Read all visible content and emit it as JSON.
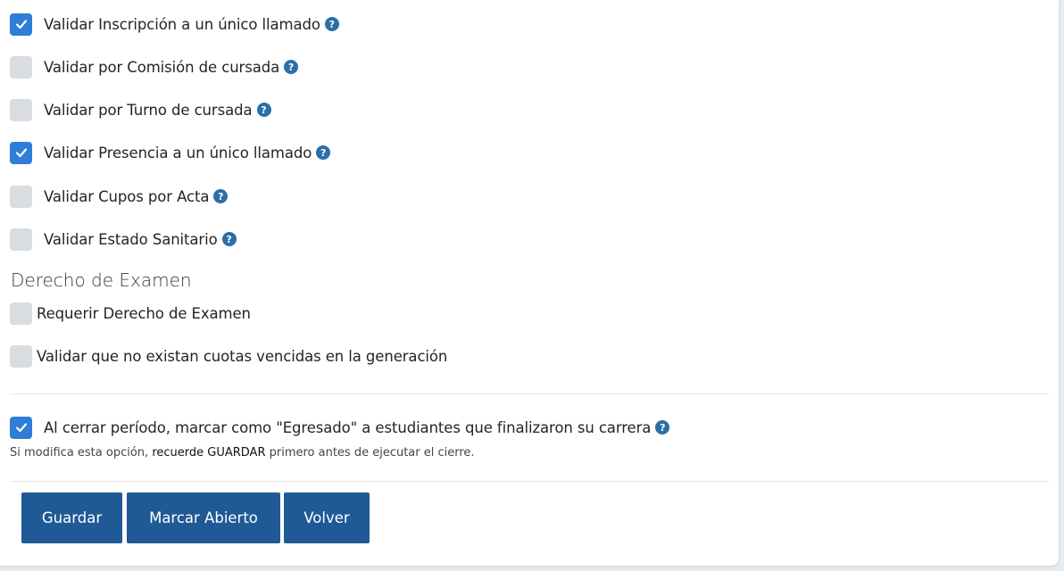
{
  "validations": [
    {
      "label": "Validar Inscripción a un único llamado",
      "checked": true
    },
    {
      "label": "Validar por Comisión de cursada",
      "checked": false
    },
    {
      "label": "Validar por Turno de cursada",
      "checked": false
    },
    {
      "label": "Validar Presencia a un único llamado",
      "checked": true
    },
    {
      "label": "Validar Cupos por Acta",
      "checked": false
    },
    {
      "label": "Validar Estado Sanitario",
      "checked": false
    }
  ],
  "derecho_examen": {
    "title": "Derecho de Examen",
    "items": [
      {
        "label": "Requerir Derecho de Examen",
        "checked": false
      },
      {
        "label": "Validar que no existan cuotas vencidas en la generación",
        "checked": false
      }
    ]
  },
  "egresado": {
    "label": "Al cerrar período, marcar como \"Egresado\" a estudiantes que finalizaron su carrera",
    "checked": true,
    "note_prefix": "Si modifica esta opción, ",
    "note_strong": "recuerde GUARDAR",
    "note_suffix": " primero antes de ejecutar el cierre."
  },
  "help_glyph": "?",
  "buttons": {
    "save": "Guardar",
    "mark_open": "Marcar Abierto",
    "back": "Volver"
  },
  "colors": {
    "checkbox_checked": "#2f7dd6",
    "checkbox_unchecked": "#d9dde1",
    "help_icon": "#2a6fa8",
    "button": "#1f5a96"
  }
}
